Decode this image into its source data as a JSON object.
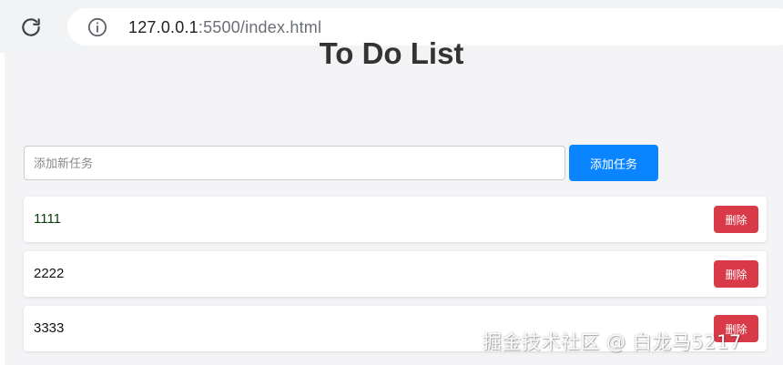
{
  "browser": {
    "url_host": "127.0.0.1",
    "url_rest": ":5500/index.html"
  },
  "app": {
    "title": "To Do List",
    "input_placeholder": "添加新任务",
    "add_button_label": "添加任务"
  },
  "tasks": [
    {
      "text": "1111",
      "delete_label": "删除"
    },
    {
      "text": "2222",
      "delete_label": "删除"
    },
    {
      "text": "3333",
      "delete_label": "删除"
    }
  ],
  "watermark": "掘金技术社区 @ 白龙马5217",
  "colors": {
    "add_button": "#0a84ff",
    "delete_button": "#d83a48",
    "page_background": "#f4f4f6"
  }
}
